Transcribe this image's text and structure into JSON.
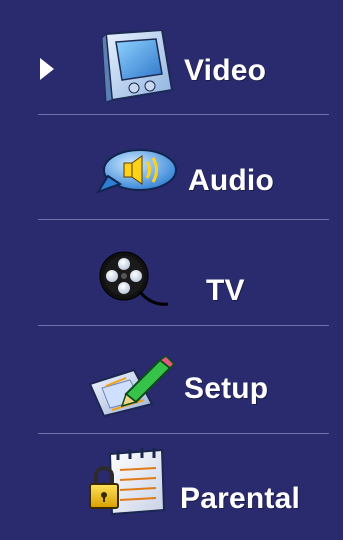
{
  "menu": {
    "selected_index": 0,
    "items": [
      {
        "label": "Video",
        "icon": "video-player-icon"
      },
      {
        "label": "Audio",
        "icon": "speaker-bubble-icon"
      },
      {
        "label": "TV",
        "icon": "film-reel-icon"
      },
      {
        "label": "Setup",
        "icon": "pencil-document-icon"
      },
      {
        "label": "Parental",
        "icon": "lock-notepad-icon"
      }
    ]
  },
  "colors": {
    "panel_background": "#2a2b6f",
    "divider": "#6f71a8",
    "text": "#ffffff"
  }
}
